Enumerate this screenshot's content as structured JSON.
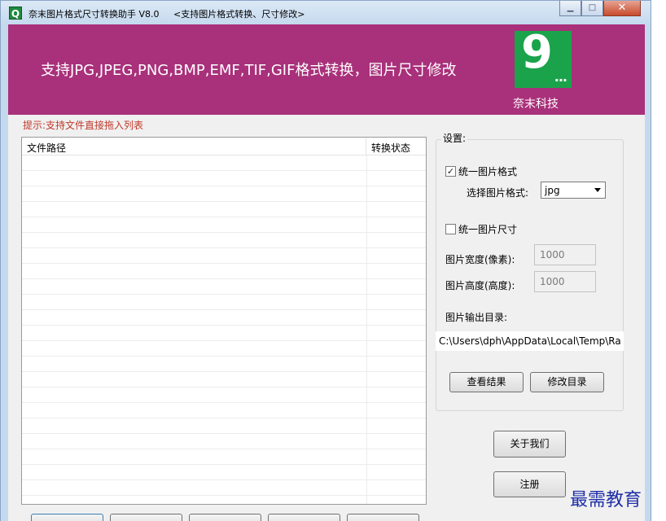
{
  "window": {
    "title": "奈末图片格式尺寸转换助手 V8.0",
    "subtitle": "<支持图片格式转换、尺寸修改>",
    "icon_letter": "Q"
  },
  "banner": {
    "tagline": "支持JPG,JPEG,PNG,BMP,EMF,TIF,GIF格式转换，图片尺寸修改",
    "company": "奈末科技",
    "logo_digit": "9",
    "logo_dots": "...",
    "background_color": "#a9307a",
    "logo_color": "#1aa34a"
  },
  "main": {
    "hint": "提示:支持文件直接拖入列表",
    "columns": {
      "path": "文件路径",
      "status": "转换状态"
    }
  },
  "settings": {
    "label": "设置:",
    "unify_format": {
      "label": "统一图片格式",
      "checked": true
    },
    "format_select": {
      "label": "选择图片格式:",
      "value": "jpg"
    },
    "unify_size": {
      "label": "统一图片尺寸",
      "checked": false
    },
    "width": {
      "label": "图片宽度(像素):",
      "value": "1000"
    },
    "height": {
      "label": "图片高度(高度):",
      "value": "1000"
    },
    "output_dir": {
      "label": "图片输出目录:",
      "value": "C:\\Users\\dph\\AppData\\Local\\Temp\\Ra"
    },
    "view_result_label": "查看结果",
    "change_dir_label": "修改目录"
  },
  "actions": {
    "about_label": "关于我们",
    "register_label": "注册"
  },
  "watermark": "最需教育"
}
